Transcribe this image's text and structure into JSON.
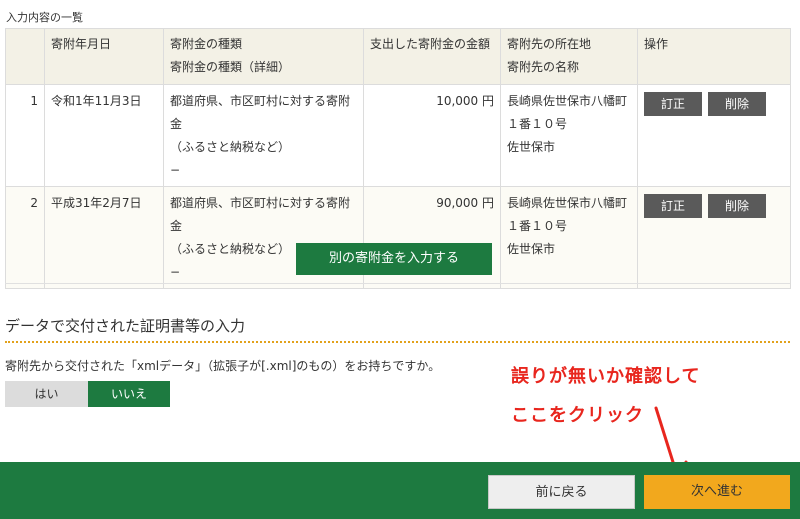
{
  "list_title": "入力内容の一覧",
  "table": {
    "headers": {
      "date": "寄附年月日",
      "type_line1": "寄附金の種類",
      "type_line2": "寄附金の種類（詳細）",
      "amount": "支出した寄附金の金額",
      "place_line1": "寄附先の所在地",
      "place_line2": "寄附先の名称",
      "ops": "操作"
    },
    "rows": [
      {
        "index": "1",
        "date": "令和1年11月3日",
        "type_line1": "都道府県、市区町村に対する寄附金",
        "type_line2": "（ふるさと納税など）",
        "type_line3": "−",
        "amount": "10,000 円",
        "address_line1": "長崎県佐世保市八幡町",
        "address_line2": "１番１０号",
        "name": "佐世保市",
        "edit_label": "訂正",
        "delete_label": "削除"
      },
      {
        "index": "2",
        "date": "平成31年2月7日",
        "type_line1": "都道府県、市区町村に対する寄附金",
        "type_line2": "（ふるさと納税など）",
        "type_line3": "−",
        "amount": "90,000 円",
        "address_line1": "長崎県佐世保市八幡町",
        "address_line2": "１番１０号",
        "name": "佐世保市",
        "edit_label": "訂正",
        "delete_label": "削除"
      }
    ]
  },
  "add_button_label": "別の寄附金を入力する",
  "xml_section": {
    "title": "データで交付された証明書等の入力",
    "question": "寄附先から交付された「xmlデータ」（拡張子が[.xml]のもの）をお持ちですか。",
    "yes_label": "はい",
    "no_label": "いいえ",
    "selected": "いいえ"
  },
  "annotation": {
    "line1": "誤りが無いか確認して",
    "line2": "ここをクリック",
    "color": "#e8261e"
  },
  "footer": {
    "back_label": "前に戻る",
    "next_label": "次へ進む"
  },
  "colors": {
    "primary_green": "#1d7a40",
    "next_orange": "#f2a81d",
    "header_bg": "#f3f1e6",
    "accent_dotted": "#e2a21c"
  }
}
